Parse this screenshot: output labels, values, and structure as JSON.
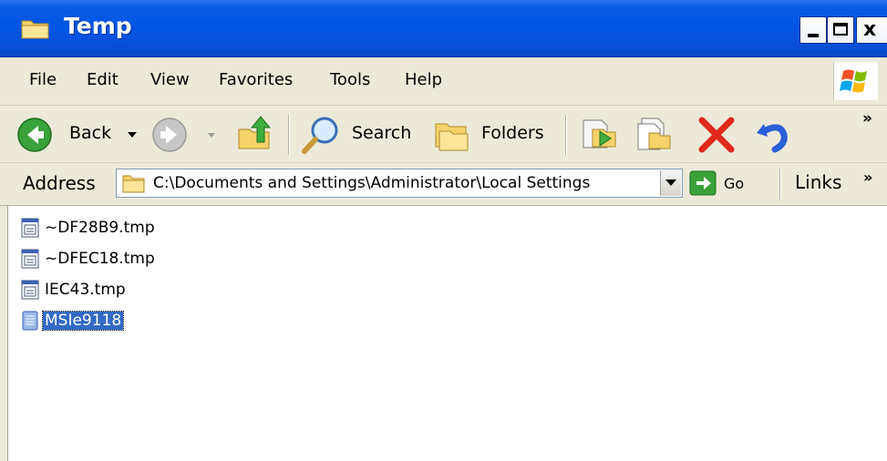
{
  "window": {
    "title": "Temp",
    "controls": {
      "minimize_icon": "minimize-icon",
      "maximize_icon": "maximize-icon",
      "close_label": "x"
    }
  },
  "menu": {
    "items": [
      "File",
      "Edit",
      "View",
      "Favorites",
      "Tools",
      "Help"
    ]
  },
  "toolbar": {
    "back_label": "Back",
    "search_label": "Search",
    "folders_label": "Folders",
    "overflow": "»",
    "icons": [
      "back-arrow-icon",
      "forward-arrow-icon",
      "up-folder-icon",
      "search-icon",
      "folders-icon",
      "move-to-icon",
      "copy-to-icon",
      "delete-icon",
      "undo-icon"
    ],
    "colors": {
      "back_green": "#3aa23a",
      "delete_red": "#e0281c",
      "undo_blue": "#2a5fd8"
    }
  },
  "address": {
    "label": "Address",
    "value": "C:\\Documents and Settings\\Administrator\\Local Settings",
    "go_label": "Go",
    "links_label": "Links",
    "links_overflow": "»"
  },
  "files": [
    {
      "name": "~DF28B9.tmp",
      "icon": "tmp-file-icon",
      "selected": false
    },
    {
      "name": "~DFEC18.tmp",
      "icon": "tmp-file-icon",
      "selected": false
    },
    {
      "name": "IEC43.tmp",
      "icon": "tmp-file-icon",
      "selected": false
    },
    {
      "name": "MSIe9118",
      "icon": "text-file-icon",
      "selected": true
    }
  ],
  "colors": {
    "titlebar_blue": "#0055e5",
    "chrome": "#ece9d8",
    "selection": "#316ac5"
  }
}
